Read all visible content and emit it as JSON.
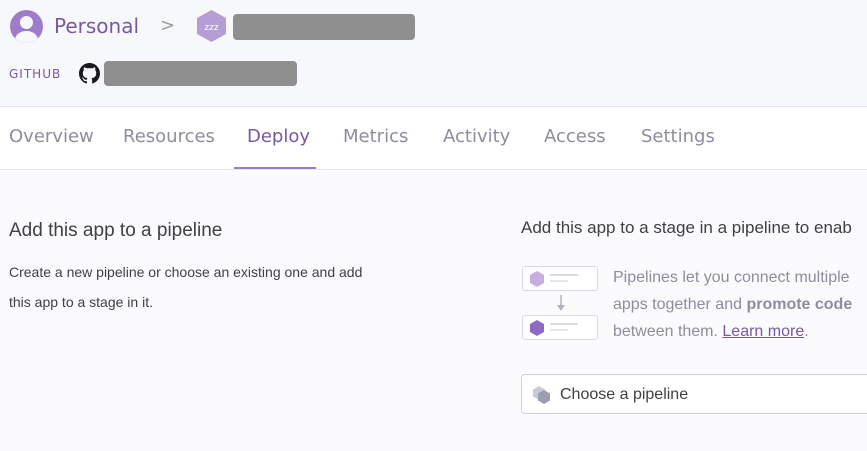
{
  "header": {
    "account_label": "Personal",
    "separator": ">",
    "app_icon_text": "zzz",
    "github_label": "GITHUB"
  },
  "tabs": [
    {
      "label": "Overview",
      "active": false
    },
    {
      "label": "Resources",
      "active": false
    },
    {
      "label": "Deploy",
      "active": true
    },
    {
      "label": "Metrics",
      "active": false
    },
    {
      "label": "Activity",
      "active": false
    },
    {
      "label": "Access",
      "active": false
    },
    {
      "label": "Settings",
      "active": false
    }
  ],
  "pipeline_section": {
    "title": "Add this app to a pipeline",
    "description": "Create a new pipeline or choose an existing one and add this app to a stage in it.",
    "right_title": "Add this app to a stage in a pipeline to enab",
    "right_desc_line1": "Pipelines let you connect multiple",
    "right_desc_line2_pre": "apps together and ",
    "right_desc_line2_bold": "promote code",
    "right_desc_line3_pre": "between them. ",
    "learn_more": "Learn more",
    "right_desc_line3_post": ".",
    "select_label": "Choose a pipeline"
  },
  "colors": {
    "accent": "#79589f",
    "accent_light": "#9e7cc9",
    "muted_text": "#8d8d9c",
    "redacted": "#8f8f8f"
  },
  "icons": [
    "user-avatar-icon",
    "chevron-right-icon",
    "sleeping-app-icon",
    "github-icon",
    "pipeline-illustration-icon",
    "pipeline-stack-icon"
  ]
}
